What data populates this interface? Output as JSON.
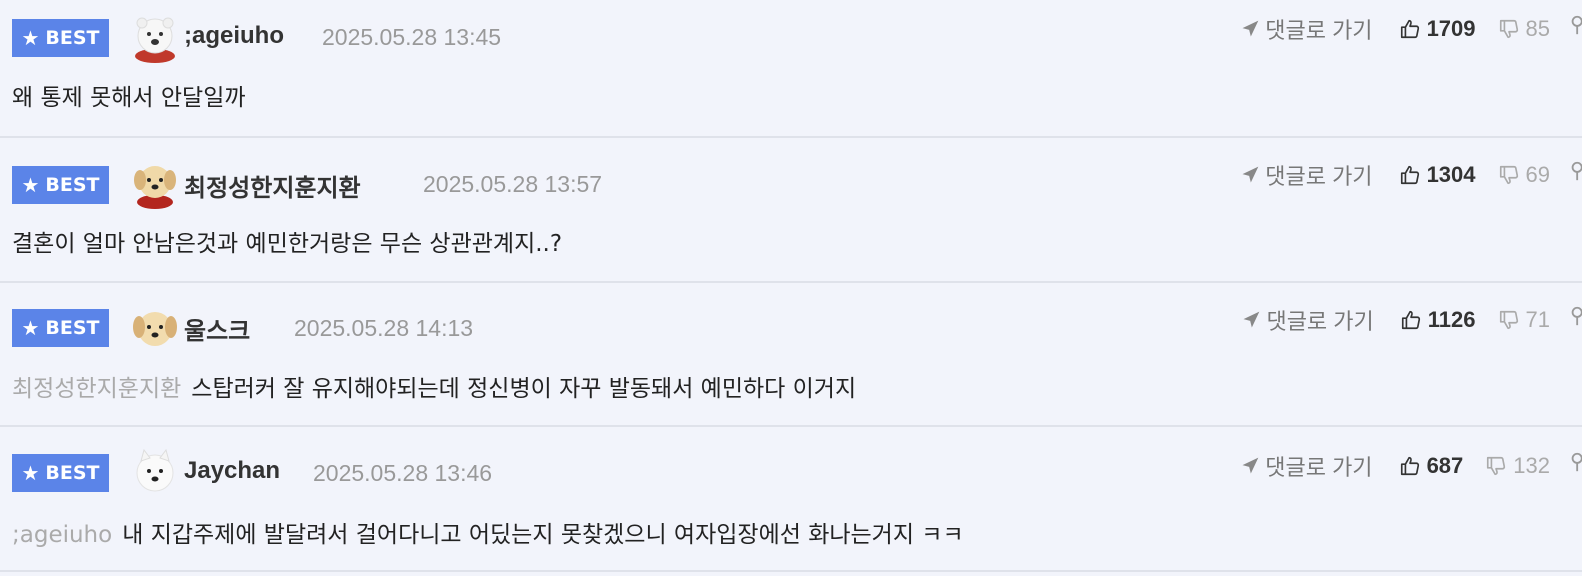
{
  "comments": [
    {
      "badge": "BEST",
      "author": ";ageiuho",
      "avatar": "polar-bear",
      "date": "2025.05.28 13:45",
      "goto_label": "댓글로 가기",
      "likes": "1709",
      "dislikes": "85",
      "reply_to": "",
      "text": "왜 통제 못해서 안달일까"
    },
    {
      "badge": "BEST",
      "author": "최정성한지훈지환",
      "avatar": "puppy-red-scarf",
      "date": "2025.05.28 13:57",
      "goto_label": "댓글로 가기",
      "likes": "1304",
      "dislikes": "69",
      "reply_to": "",
      "text": "결혼이 얼마 안남은것과 예민한거랑은 무슨 상관관계지..?"
    },
    {
      "badge": "BEST",
      "author": "울스크",
      "avatar": "puppy",
      "date": "2025.05.28 14:13",
      "goto_label": "댓글로 가기",
      "likes": "1126",
      "dislikes": "71",
      "reply_to": "최정성한지훈지환",
      "text": "스탑러커 잘 유지해야되는데 정신병이 자꾸 발동돼서 예민하다 이거지"
    },
    {
      "badge": "BEST",
      "author": "Jaychan",
      "avatar": "white-dog",
      "date": "2025.05.28 13:46",
      "goto_label": "댓글로 가기",
      "likes": "687",
      "dislikes": "132",
      "reply_to": ";ageiuho",
      "text": "내 지갑주제에 발달려서 걸어다니고 어딨는지 못찾겠으니 여자입장에선 화나는거지 ㅋㅋ"
    }
  ],
  "colors": {
    "background": "#f2f4fb",
    "best_badge": "#5b84e8",
    "divider": "#dfe2ea",
    "muted_text": "#999999"
  }
}
